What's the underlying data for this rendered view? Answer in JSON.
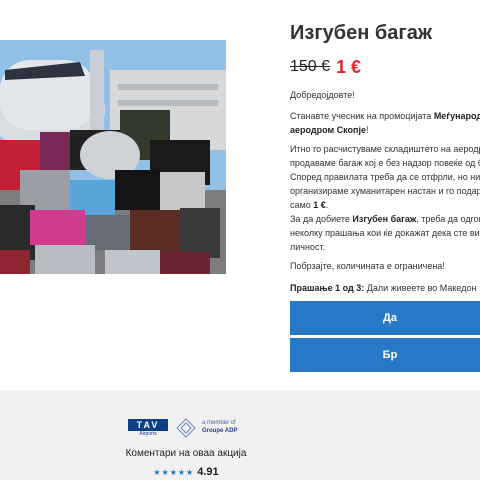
{
  "product": {
    "title": "Изгубен багаж",
    "price_old": "150 €",
    "price_new": "1 €"
  },
  "description": {
    "greeting": "Добредојдовте!",
    "intro_1": "Станавте учесник на промоцијата ",
    "intro_bold_1": "Меѓународе",
    "intro_bold_2": "аеродром Скопје",
    "intro_2": "!",
    "body_line_1": "Итно го расчистуваме складиштето на аеродро",
    "body_line_2": "продаваме багаж кој е без надзор повеќе од 6 м",
    "body_line_3": "Според правилата треба да се отфрли, но ние",
    "body_line_4": "организираме хуманитарен настан и го подару",
    "body_line_5_pre": "само ",
    "body_line_5_bold": "1 €",
    "body_line_5_post": ".",
    "task_pre": "За да добиете ",
    "task_bold": "Изгубен багаж",
    "task_post": ", треба да одгово",
    "task_line_2": "неколку прашања кои ќе докажат дека сте вист",
    "task_line_3": "личност.",
    "hurry": "Побрзајте, количината е ограничена!"
  },
  "quiz": {
    "question_label": "Прашање 1 од 3:",
    "question_text": " Дали живеете во Македон",
    "answer_yes": "Да",
    "answer_no": "Бр"
  },
  "footer": {
    "tav_logo": "TAV",
    "tav_sub": "Airports",
    "adp_line_1": "a member of",
    "adp_line_2": "Groupe ADP",
    "comments_label": "Коментари на оваа акција",
    "stars": "★★★★★",
    "rating": "4.91"
  },
  "colors": {
    "price_red": "#e8262d",
    "button_blue": "#2878c8",
    "footer_bg": "#f1f1f1",
    "star_blue": "#1e73be"
  }
}
